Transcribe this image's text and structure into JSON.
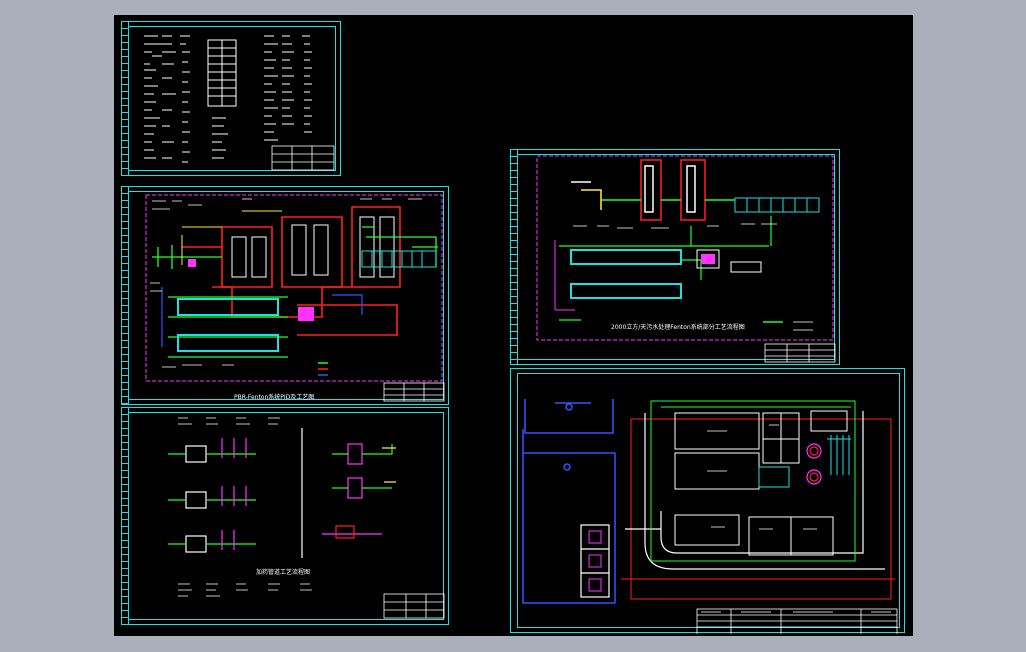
{
  "app": {
    "background": "#aab0bb",
    "canvas_color": "#000000",
    "frame_color": "#1ee0e0"
  },
  "sheets": {
    "notes": {
      "title": ""
    },
    "pid": {
      "title": "PBR-Fenton系统PID及工艺图"
    },
    "dosing": {
      "title": "加药管道工艺流程图"
    },
    "process": {
      "title": "2000立方/天污水处理Fenton系统部分工艺流程图"
    },
    "layout": {
      "title": ""
    }
  },
  "colors": {
    "red": "#ff2020",
    "green": "#22ff22",
    "cyan": "#1ee0e0",
    "magenta": "#ff33ff",
    "blue": "#3355ff",
    "yellow": "#ffee33",
    "white": "#ffffff"
  }
}
